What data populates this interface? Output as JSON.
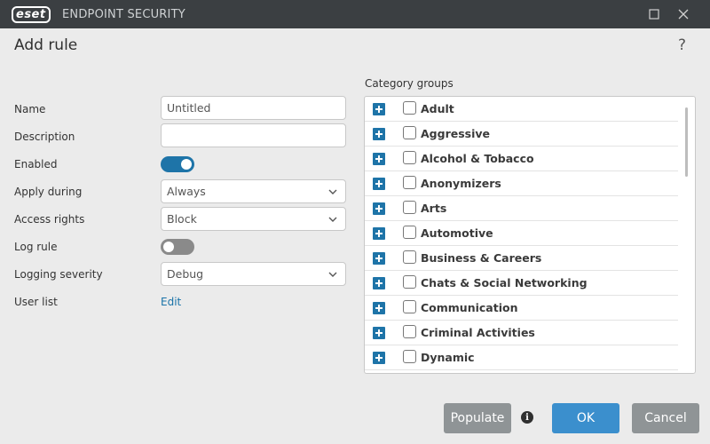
{
  "app": {
    "logo_text": "eset",
    "title": "ENDPOINT SECURITY"
  },
  "dialog": {
    "title": "Add rule",
    "help_glyph": "?"
  },
  "form": {
    "name_label": "Name",
    "name_value": "Untitled",
    "description_label": "Description",
    "description_value": "",
    "enabled_label": "Enabled",
    "enabled": true,
    "apply_during_label": "Apply during",
    "apply_during_value": "Always",
    "access_rights_label": "Access rights",
    "access_rights_value": "Block",
    "log_rule_label": "Log rule",
    "log_rule": false,
    "logging_severity_label": "Logging severity",
    "logging_severity_value": "Debug",
    "user_list_label": "User list",
    "user_list_link": "Edit"
  },
  "categories": {
    "title": "Category groups",
    "items": [
      {
        "label": "Adult",
        "checked": false
      },
      {
        "label": "Aggressive",
        "checked": false
      },
      {
        "label": "Alcohol & Tobacco",
        "checked": false
      },
      {
        "label": "Anonymizers",
        "checked": false
      },
      {
        "label": "Arts",
        "checked": false
      },
      {
        "label": "Automotive",
        "checked": false
      },
      {
        "label": "Business & Careers",
        "checked": false
      },
      {
        "label": "Chats & Social Networking",
        "checked": false
      },
      {
        "label": "Communication",
        "checked": false
      },
      {
        "label": "Criminal Activities",
        "checked": false
      },
      {
        "label": "Dynamic",
        "checked": false
      }
    ]
  },
  "buttons": {
    "populate": "Populate",
    "info_glyph": "i",
    "ok": "OK",
    "cancel": "Cancel"
  },
  "colors": {
    "accent": "#1e74a8",
    "ok_button": "#3b8fcd",
    "secondary_button": "#8f9496",
    "titlebar": "#3b3f42"
  }
}
